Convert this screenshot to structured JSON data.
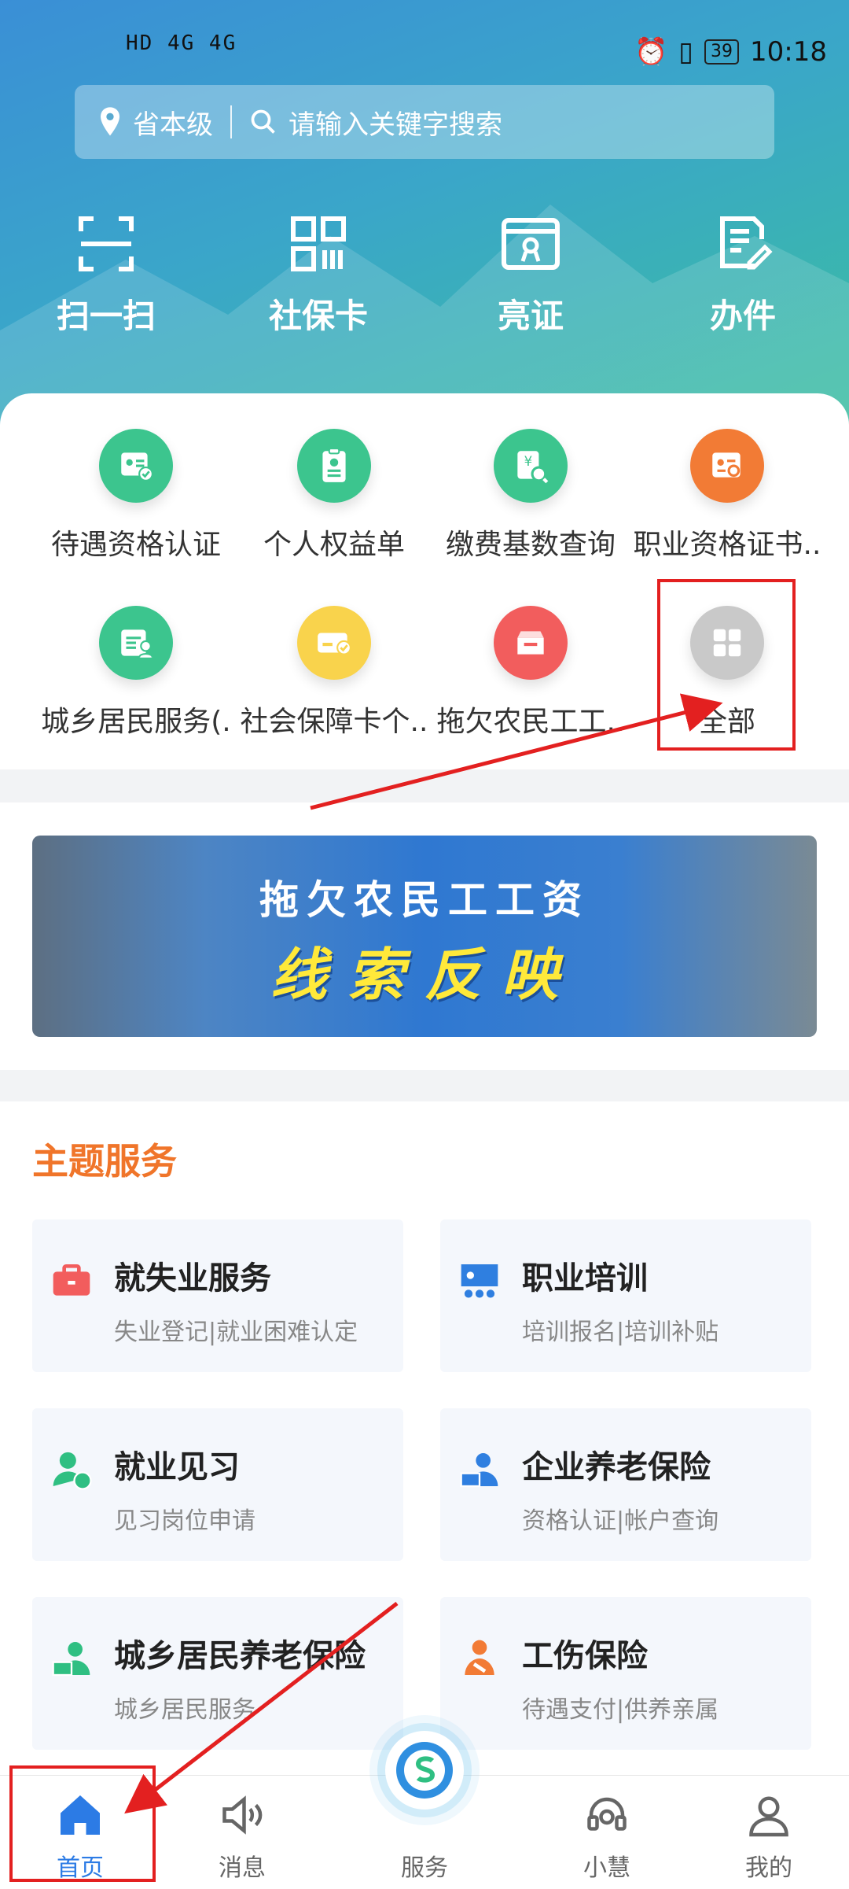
{
  "status_bar": {
    "left": "HD 4G 4G",
    "time": "10:18",
    "battery": "39"
  },
  "search": {
    "location": "省本级",
    "placeholder": "请输入关键字搜索"
  },
  "quick_actions": [
    {
      "label": "扫一扫",
      "icon": "scan-icon"
    },
    {
      "label": "社保卡",
      "icon": "qr-card-icon"
    },
    {
      "label": "亮证",
      "icon": "certificate-icon"
    },
    {
      "label": "办件",
      "icon": "edit-document-icon"
    }
  ],
  "services": [
    {
      "label": "待遇资格认证",
      "color": "#3cc58e"
    },
    {
      "label": "个人权益单",
      "color": "#3cc58e"
    },
    {
      "label": "缴费基数查询",
      "color": "#3cc58e"
    },
    {
      "label": "职业资格证书..",
      "color": "#f27b35"
    },
    {
      "label": "城乡居民服务(.",
      "color": "#3cc58e"
    },
    {
      "label": "社会保障卡个..",
      "color": "#f9d34c"
    },
    {
      "label": "拖欠农民工工..",
      "color": "#f25d5d"
    },
    {
      "label": "全部",
      "color": "#c9c9c9"
    }
  ],
  "banner": {
    "line1": "拖欠农民工工资",
    "line2": "线索反映"
  },
  "topic": {
    "title": "主题服务",
    "tiles": [
      {
        "title": "就失业服务",
        "subtitle": "失业登记|就业困难认定",
        "color": "#f25d5d"
      },
      {
        "title": "职业培训",
        "subtitle": "培训报名|培训补贴",
        "color": "#2f7fe0"
      },
      {
        "title": "就业见习",
        "subtitle": "见习岗位申请",
        "color": "#2fbf82"
      },
      {
        "title": "企业养老保险",
        "subtitle": "资格认证|帐户查询",
        "color": "#2f7fe0"
      },
      {
        "title": "城乡居民养老保险",
        "subtitle": "城乡居民服务",
        "color": "#2fbf82"
      },
      {
        "title": "工伤保险",
        "subtitle": "待遇支付|供养亲属",
        "color": "#f27b35"
      }
    ]
  },
  "tabs": [
    {
      "label": "首页"
    },
    {
      "label": "消息"
    },
    {
      "label": "服务"
    },
    {
      "label": "小慧"
    },
    {
      "label": "我的"
    }
  ],
  "colors": {
    "accent": "#2c7be5",
    "topic_title": "#f0752a",
    "annotation": "#e32020"
  }
}
